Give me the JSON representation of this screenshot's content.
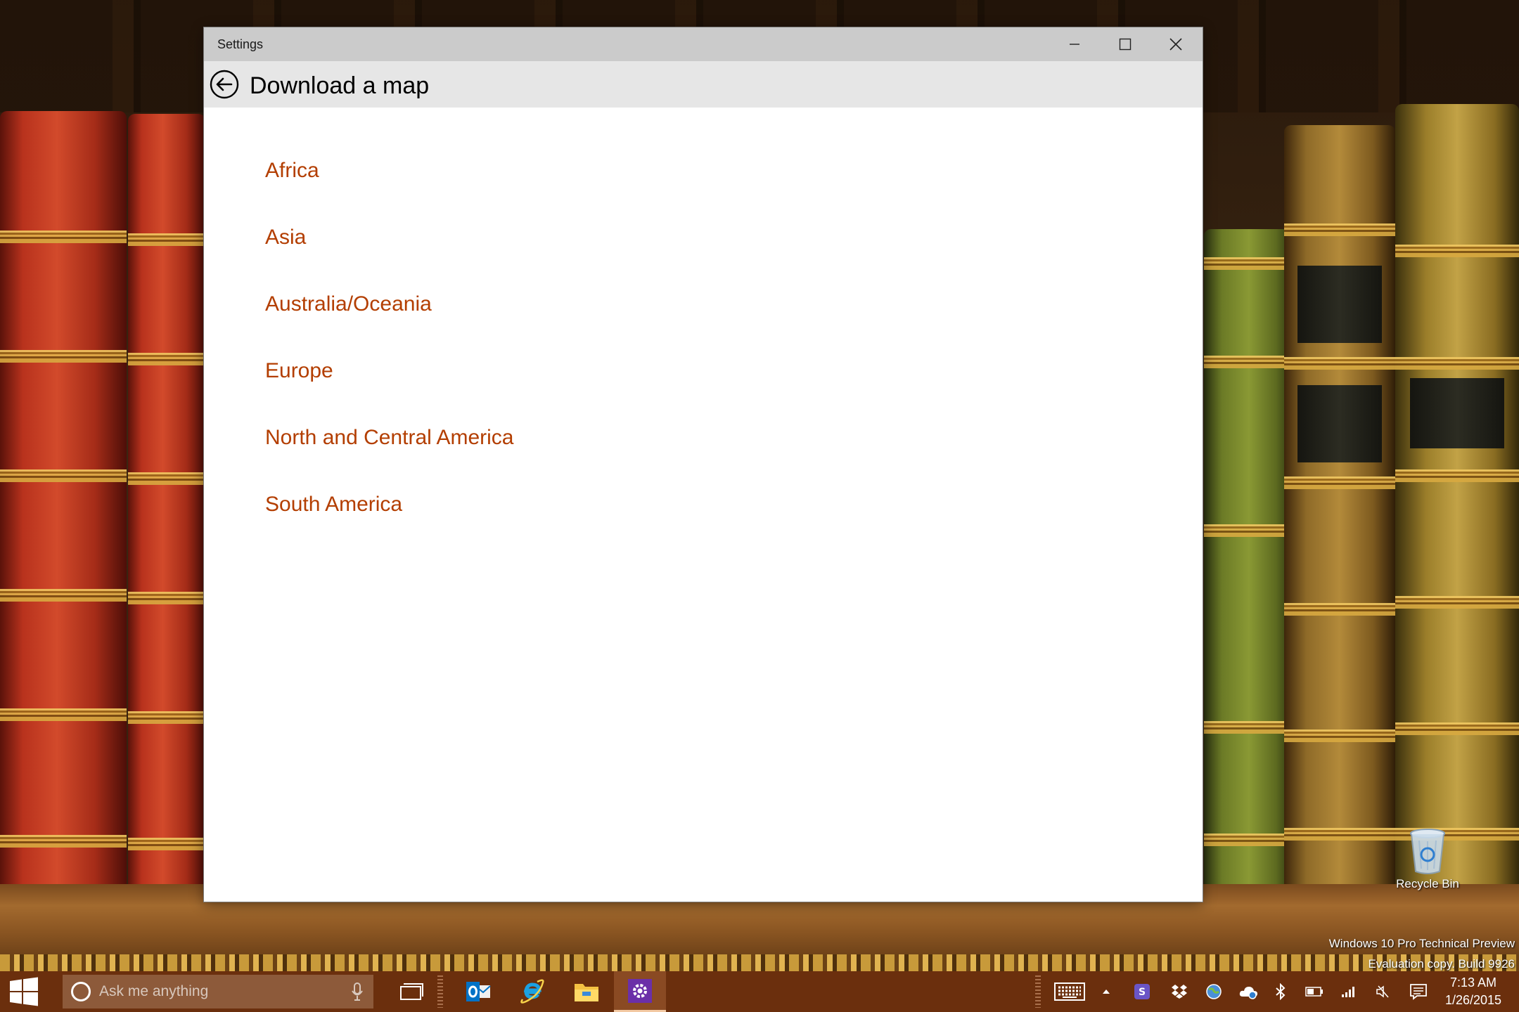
{
  "window": {
    "title": "Settings",
    "page_title": "Download a map"
  },
  "regions": [
    {
      "label": "Africa"
    },
    {
      "label": "Asia"
    },
    {
      "label": "Australia/Oceania"
    },
    {
      "label": "Europe"
    },
    {
      "label": "North and Central America"
    },
    {
      "label": "South America"
    }
  ],
  "desktop": {
    "recycle_bin_label": "Recycle Bin",
    "watermark_line1": "Windows 10 Pro Technical Preview",
    "watermark_line2": "Evaluation copy. Build 9926"
  },
  "taskbar": {
    "search_placeholder": "Ask me anything",
    "pinned": [
      "task-view-icon",
      "outlook-icon",
      "internet-explorer-icon",
      "file-explorer-icon",
      "settings-icon"
    ],
    "active_app": "settings-icon",
    "tray_icons": [
      "touch-keyboard-icon",
      "show-hidden-icons-icon",
      "skype-icon",
      "dropbox-icon",
      "globe-icon",
      "onedrive-icon",
      "bluetooth-icon",
      "battery-icon",
      "network-signal-icon",
      "volume-muted-icon",
      "action-center-icon"
    ],
    "time": "7:13 AM",
    "date": "1/26/2015"
  },
  "colors": {
    "accent_text": "#b33e00",
    "taskbar": "#6b2f0d",
    "titlebar": "#cbcbcb",
    "header": "#e6e6e6"
  }
}
